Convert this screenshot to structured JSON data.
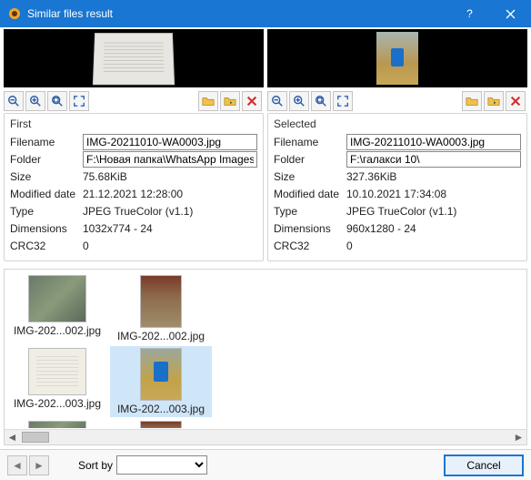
{
  "window": {
    "title": "Similar files result"
  },
  "panels": {
    "first": {
      "heading": "First",
      "filename_label": "Filename",
      "filename": "IMG-20211010-WA0003.jpg",
      "folder_label": "Folder",
      "folder": "F:\\Новая папка\\WhatsApp Images\\",
      "size_label": "Size",
      "size": "75.68KiB",
      "modified_label": "Modified date",
      "modified": "21.12.2021 12:28:00",
      "type_label": "Type",
      "type": "JPEG TrueColor (v1.1)",
      "dim_label": "Dimensions",
      "dim": "1032x774 - 24",
      "crc_label": "CRC32",
      "crc": "0"
    },
    "selected": {
      "heading": "Selected",
      "filename_label": "Filename",
      "filename": "IMG-20211010-WA0003.jpg",
      "folder_label": "Folder",
      "folder": "F:\\галакси 10\\",
      "size_label": "Size",
      "size": "327.36KiB",
      "modified_label": "Modified date",
      "modified": "10.10.2021 17:34:08",
      "type_label": "Type",
      "type": "JPEG TrueColor (v1.1)",
      "dim_label": "Dimensions",
      "dim": "960x1280 - 24",
      "crc_label": "CRC32",
      "crc": "0"
    }
  },
  "toolbar_icons": [
    "zoom-out",
    "zoom-in",
    "fit",
    "fullscreen",
    "open-folder",
    "move",
    "delete"
  ],
  "thumbnails": [
    {
      "caption": "IMG-202...002.jpg",
      "kind": "rubble"
    },
    {
      "caption": "IMG-202...002.jpg",
      "kind": "people"
    },
    {
      "caption": "IMG-202...003.jpg",
      "kind": "doc"
    },
    {
      "caption": "IMG-202...003.jpg",
      "kind": "leaves",
      "selected": true
    }
  ],
  "footer": {
    "sort_label": "Sort by",
    "cancel": "Cancel"
  }
}
